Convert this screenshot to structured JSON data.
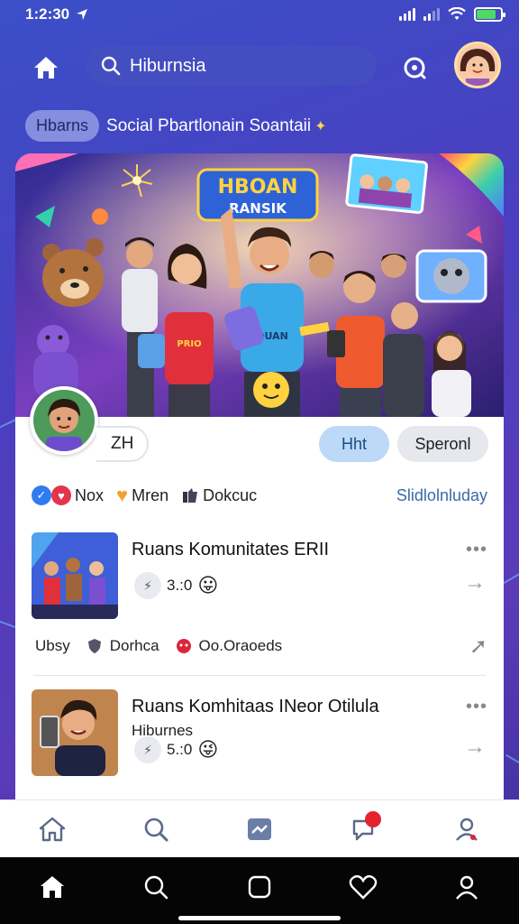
{
  "status_bar": {
    "time": "1:2:30"
  },
  "header": {
    "search_value": "Hiburnsia",
    "search_placeholder": "Hiburnsia"
  },
  "title_row": {
    "tag": "Hbarns",
    "title": "Social Pbartlonain Soantaii"
  },
  "banner": {
    "logo_line1": "HBOAN",
    "logo_line2": "RANSIK",
    "shirt_text": "PRIO",
    "shirt_text2": "OUAN"
  },
  "profile": {
    "chip_label": "ZH",
    "primary_button": "Hht",
    "secondary_button": "Speronl"
  },
  "reactions": {
    "group1_label": "Nox",
    "group2_label": "Mren",
    "group3_label": "Dokcuc",
    "right_link": "Slidlolnluday"
  },
  "posts": [
    {
      "title": "Ruans Komunitates ERII",
      "subtitle": "",
      "meta_count": "3.:0"
    },
    {
      "title": "Ruans Komhitaas INeor Otilula",
      "subtitle": "Hiburnes",
      "meta_count": "5.:0"
    }
  ],
  "actions": {
    "label1": "Ubsy",
    "label2": "Dorhca",
    "label3": "Oo.Oraoeds"
  },
  "colors": {
    "background": "#4a3fc0",
    "accent_blue": "#bcd9f7",
    "badge_red": "#e5232f"
  }
}
